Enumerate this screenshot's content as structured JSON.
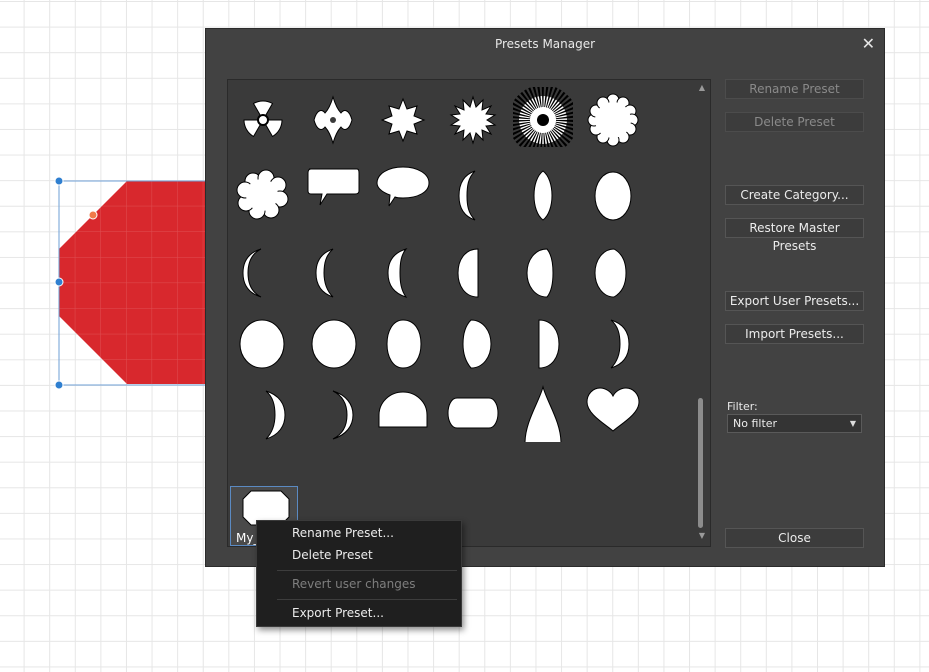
{
  "dialog": {
    "title": "Presets Manager",
    "close_glyph": "✕",
    "buttons": {
      "rename": "Rename Preset",
      "delete": "Delete Preset",
      "create_category": "Create Category...",
      "restore_master": "Restore Master Presets",
      "export_user": "Export User Presets...",
      "import": "Import Presets...",
      "close": "Close"
    },
    "filter": {
      "label": "Filter:",
      "value": "No filter"
    },
    "scroll_icons": {
      "up": "▲",
      "down": "▼"
    },
    "presets": [
      "radiation-shape",
      "cross-star-shape",
      "star-burst-shape",
      "sun-burst-shape",
      "rays-shape",
      "cloud-flower-shape",
      "cloud-shape",
      "rectangular-speech-bubble-shape",
      "oval-speech-bubble-shape",
      "crescent-left-shape",
      "lens-shape",
      "ellipse-shape",
      "thin-crescent-shape",
      "crescent-shape",
      "crescent-shape",
      "half-moon-shape",
      "gibbous-shape",
      "gibbous-shape",
      "circle-shape",
      "circle-shape",
      "ellipse-shape",
      "gibbous-right-shape",
      "half-moon-right-shape",
      "crescent-right-shape",
      "crescent-right-shape",
      "thin-crescent-right-shape",
      "half-circle-shape",
      "rounded-rectangle-shape",
      "tear-shape",
      "heart-shape"
    ],
    "user_preset": {
      "label": "My_",
      "icon": "octagon-shape"
    }
  },
  "context_menu": {
    "items": [
      {
        "label": "Rename Preset...",
        "enabled": true
      },
      {
        "label": "Delete Preset",
        "enabled": true
      },
      {
        "label": "Revert user changes",
        "enabled": false
      },
      {
        "label": "Export Preset...",
        "enabled": true
      }
    ]
  },
  "colors": {
    "canvas_shape_fill": "#d8282d",
    "selection_handle": "#2f7fd0",
    "corner_handle": "#f07a4a",
    "dialog_bg": "#424242"
  }
}
